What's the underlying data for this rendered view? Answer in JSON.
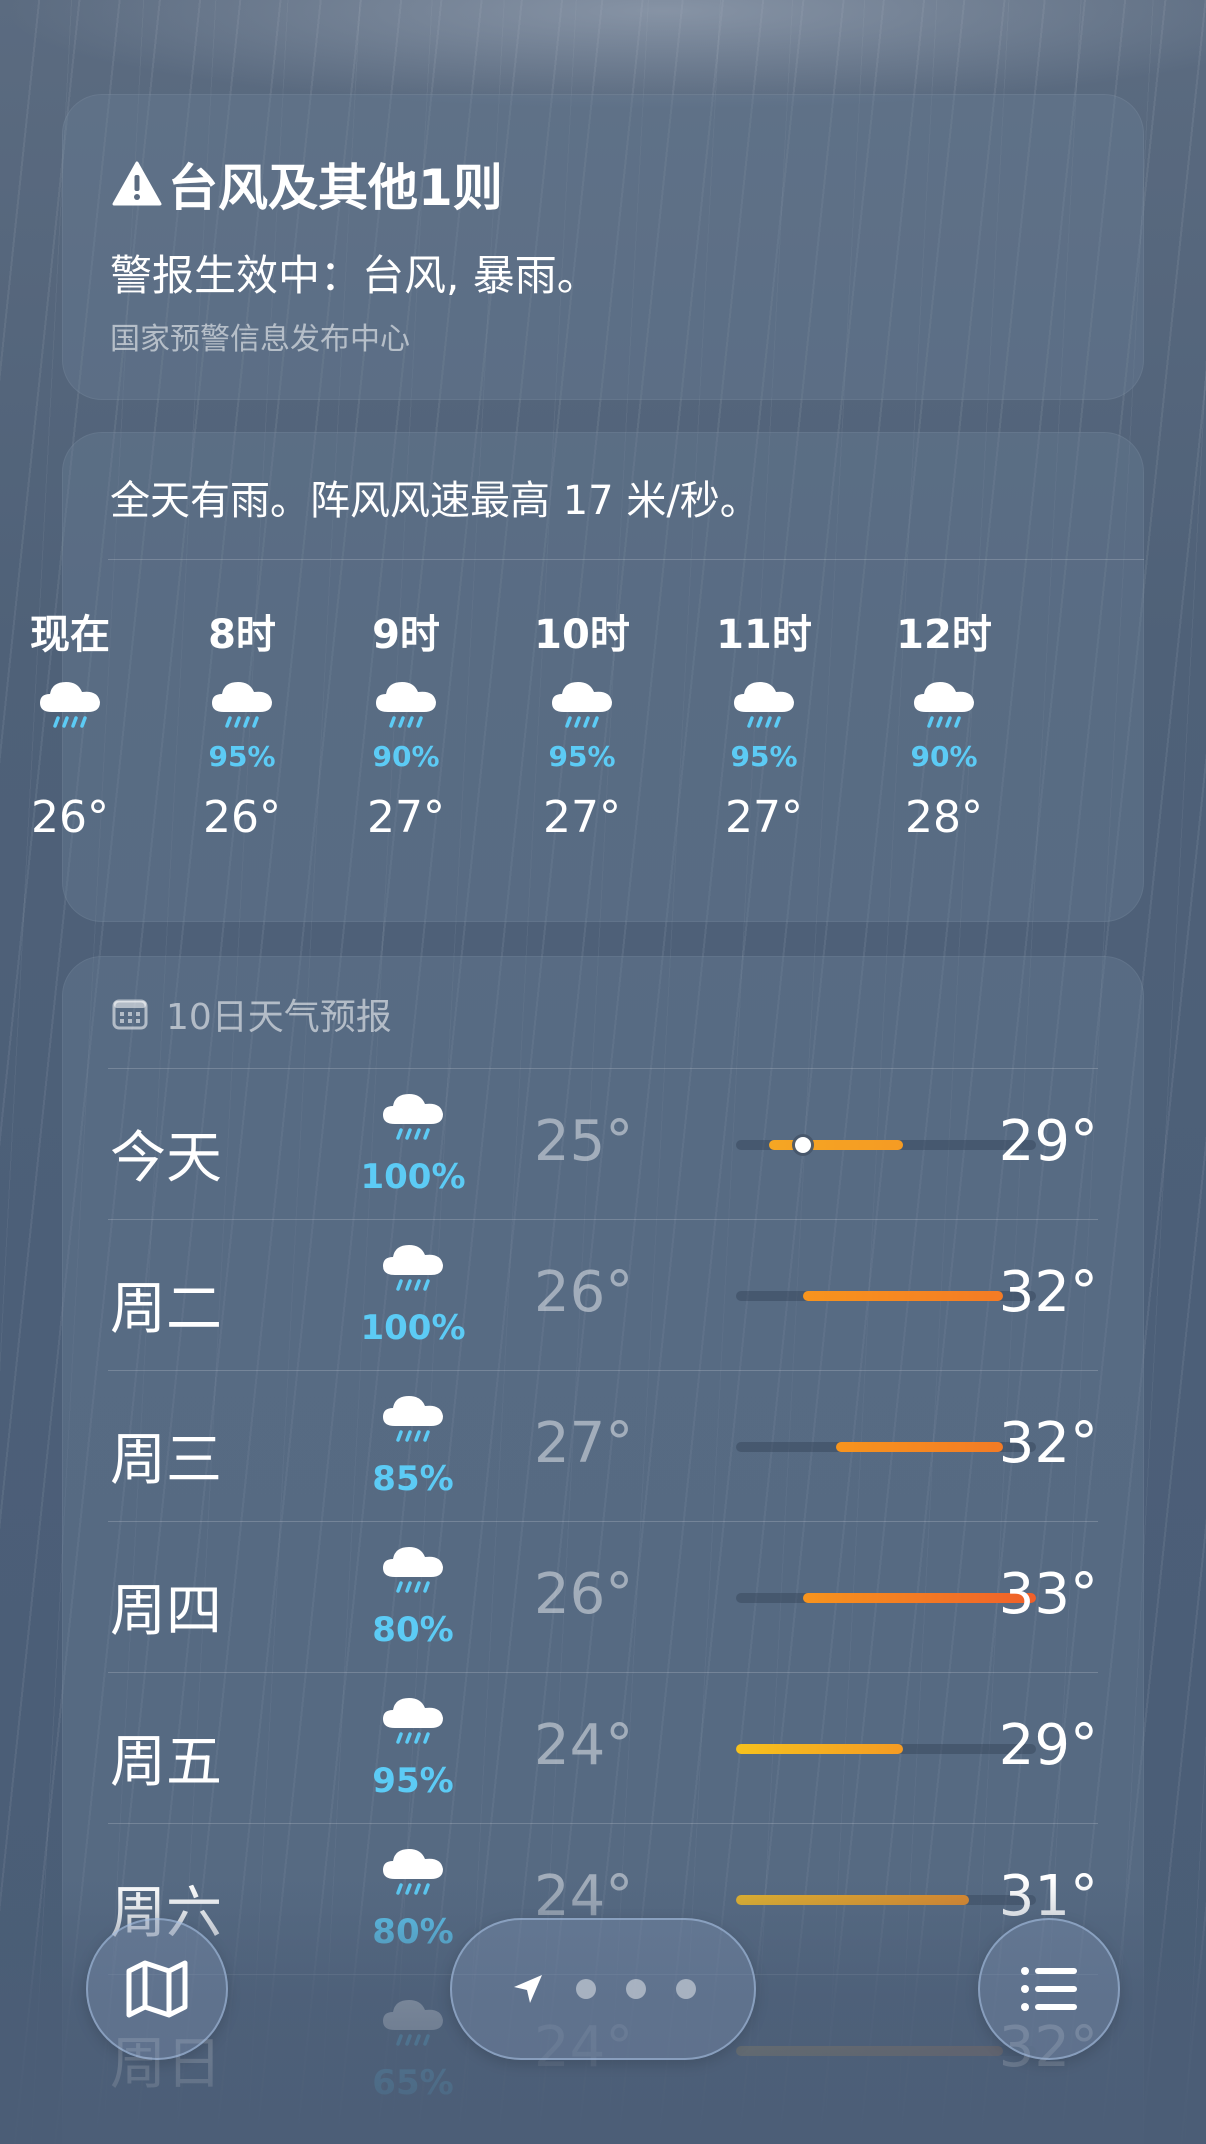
{
  "alert": {
    "title": "台风及其他1则",
    "message": "警报生效中：台风, 暴雨。",
    "source": "国家预警信息发布中心"
  },
  "hourly": {
    "summary": "全天有雨。阵风风速最高 17 米/秒。",
    "items": [
      {
        "label": "现在",
        "precip": "",
        "temp": "26°",
        "icon": "cloud-rain-icon"
      },
      {
        "label": "8时",
        "precip": "95%",
        "temp": "26°",
        "icon": "cloud-rain-icon"
      },
      {
        "label": "9时",
        "precip": "90%",
        "temp": "27°",
        "icon": "cloud-rain-icon"
      },
      {
        "label": "10时",
        "precip": "95%",
        "temp": "27°",
        "icon": "cloud-rain-icon"
      },
      {
        "label": "11时",
        "precip": "95%",
        "temp": "27°",
        "icon": "cloud-rain-icon"
      },
      {
        "label": "12时",
        "precip": "90%",
        "temp": "28°",
        "icon": "cloud-rain-icon"
      }
    ]
  },
  "daily": {
    "header": "10日天气预报",
    "scale": {
      "min": 24,
      "max": 33
    },
    "days": [
      {
        "name": "今天",
        "precip": "100%",
        "low": "25°",
        "high": "29°",
        "low_val": 25,
        "high_val": 29,
        "current_val": 26,
        "bar_colors": [
          "#f5a623",
          "#f59b23"
        ]
      },
      {
        "name": "周二",
        "precip": "100%",
        "low": "26°",
        "high": "32°",
        "low_val": 26,
        "high_val": 32,
        "bar_colors": [
          "#f7941d",
          "#f47b25"
        ]
      },
      {
        "name": "周三",
        "precip": "85%",
        "low": "27°",
        "high": "32°",
        "low_val": 27,
        "high_val": 32,
        "bar_colors": [
          "#f7941d",
          "#f47b25"
        ]
      },
      {
        "name": "周四",
        "precip": "80%",
        "low": "26°",
        "high": "33°",
        "low_val": 26,
        "high_val": 33,
        "bar_colors": [
          "#f7941d",
          "#f0602a"
        ]
      },
      {
        "name": "周五",
        "precip": "95%",
        "low": "24°",
        "high": "29°",
        "low_val": 24,
        "high_val": 29,
        "bar_colors": [
          "#f7c21d",
          "#f59b23"
        ]
      },
      {
        "name": "周六",
        "precip": "80%",
        "low": "24°",
        "high": "31°",
        "low_val": 24,
        "high_val": 31,
        "bar_colors": [
          "#e8b52a",
          "#e08a2a"
        ]
      },
      {
        "name": "周日",
        "precip": "65%",
        "low": "24°",
        "high": "32°",
        "low_val": 24,
        "high_val": 32,
        "bar_colors": [
          "#c9a45a",
          "#c08050"
        ]
      }
    ]
  },
  "controls": {
    "map_icon": "map-icon",
    "location_icon": "location-arrow-icon",
    "list_icon": "list-icon",
    "page_count": 4
  }
}
